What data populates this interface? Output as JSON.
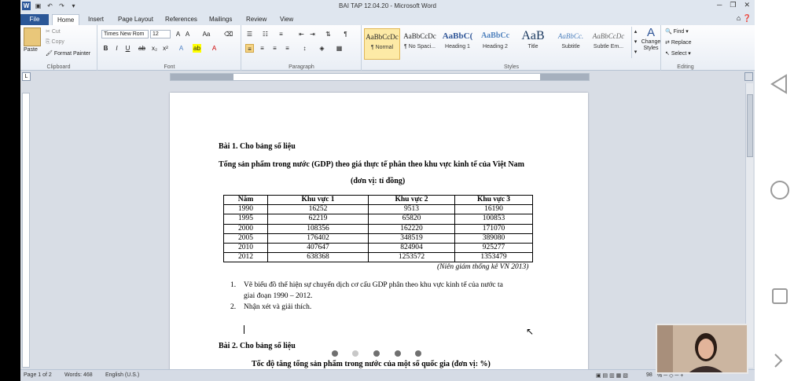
{
  "window": {
    "title": "BAI TAP 12.04.20  -  Microsoft Word",
    "app_icon": "W"
  },
  "tabs": [
    "File",
    "Home",
    "Insert",
    "Page Layout",
    "References",
    "Mailings",
    "Review",
    "View"
  ],
  "ribbon": {
    "clipboard": {
      "paste": "Paste",
      "cut": "Cut",
      "copy": "Copy",
      "format_painter": "Format Painter",
      "label": "Clipboard"
    },
    "font": {
      "name": "Times New Rom",
      "size": "12",
      "label": "Font"
    },
    "paragraph": {
      "label": "Paragraph"
    },
    "styles": {
      "items": [
        {
          "preview": "AaBbCcDc",
          "name": "¶ Normal"
        },
        {
          "preview": "AaBbCcDc",
          "name": "¶ No Spaci..."
        },
        {
          "preview": "AaBbC(",
          "name": "Heading 1"
        },
        {
          "preview": "AaBbCc",
          "name": "Heading 2"
        },
        {
          "preview": "AaB",
          "name": "Title"
        },
        {
          "preview": "AaBbCc.",
          "name": "Subtitle"
        },
        {
          "preview": "AaBbCcDc",
          "name": "Subtle Em..."
        }
      ],
      "change_styles": "Change Styles",
      "label": "Styles"
    },
    "editing": {
      "find": "Find",
      "replace": "Replace",
      "select": "Select",
      "label": "Editing"
    }
  },
  "document": {
    "ex1_title": "Bài 1. Cho bảng số liệu",
    "ex1_heading": "Tổng sản phẩm trong nước (GDP) theo giá thực tế phân theo khu vực kinh tế của Việt Nam",
    "ex1_unit": "(đơn vị: tỉ đồng)",
    "table": {
      "headers": [
        "Năm",
        "Khu vực  1",
        "Khu vực 2",
        "Khu vực 3"
      ],
      "rows": [
        [
          "1990",
          "16252",
          "9513",
          "16190"
        ],
        [
          "1995",
          "62219",
          "65820",
          "100853"
        ],
        [
          "2000",
          "108356",
          "162220",
          "171070"
        ],
        [
          "2005",
          "176402",
          "348519",
          "389080"
        ],
        [
          "2010",
          "407647",
          "824904",
          "925277"
        ],
        [
          "2012",
          "638368",
          "1253572",
          "1353479"
        ]
      ]
    },
    "source": "(Niên giám thống kê VN 2013)",
    "task1_num": "1.",
    "task1_line1": "Vẽ biểu đồ thể hiện sự chuyển dịch cơ cấu GDP phân theo khu vực kinh tế của nước ta",
    "task1_line2": "giai đoạn 1990 – 2012.",
    "task2_num": "2.",
    "task2": "Nhận xét và giải thích.",
    "ex2_title": "Bài 2. Cho bảng số liệu",
    "ex2_heading": "Tốc độ tăng tổng sản phẩm trong nước của một số quốc gia (đơn vị: %)"
  },
  "status": {
    "page": "Page 1 of 2",
    "words": "Words: 468",
    "language": "English (U.S.)",
    "zoom": "98"
  }
}
